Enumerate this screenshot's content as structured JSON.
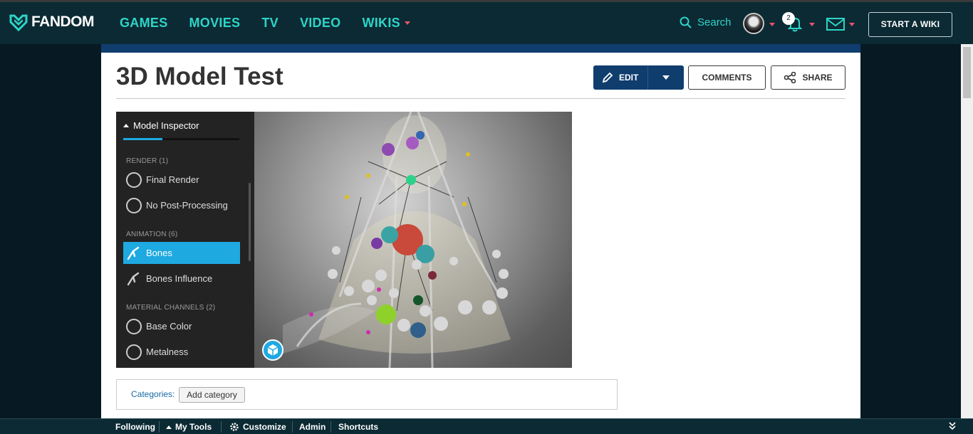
{
  "nav": {
    "logo": "FANDOM",
    "links": [
      "GAMES",
      "MOVIES",
      "TV",
      "VIDEO",
      "WIKIS"
    ],
    "search_label": "Search",
    "notification_count": "2",
    "start_wiki": "START A WIKI",
    "accent": "#2ed4c8",
    "caret_color": "#e8546e"
  },
  "article": {
    "title": "3D Model Test",
    "edit_label": "EDIT",
    "comments_label": "COMMENTS",
    "share_label": "SHARE"
  },
  "inspector": {
    "title": "Model Inspector",
    "sections": [
      {
        "label": "RENDER (1)",
        "items": [
          "Final Render",
          "No Post-Processing"
        ]
      },
      {
        "label": "ANIMATION (6)",
        "items": [
          "Bones",
          "Bones Influence"
        ]
      },
      {
        "label": "MATERIAL CHANNELS (2)",
        "items": [
          "Base Color",
          "Metalness"
        ]
      }
    ],
    "active_item": "Bones",
    "accent": "#1ea9e1"
  },
  "categories": {
    "label": "Categories:",
    "button": "Add category"
  },
  "toolbar": {
    "items": [
      "Following",
      "My Tools",
      "Customize",
      "Admin",
      "Shortcuts"
    ]
  }
}
